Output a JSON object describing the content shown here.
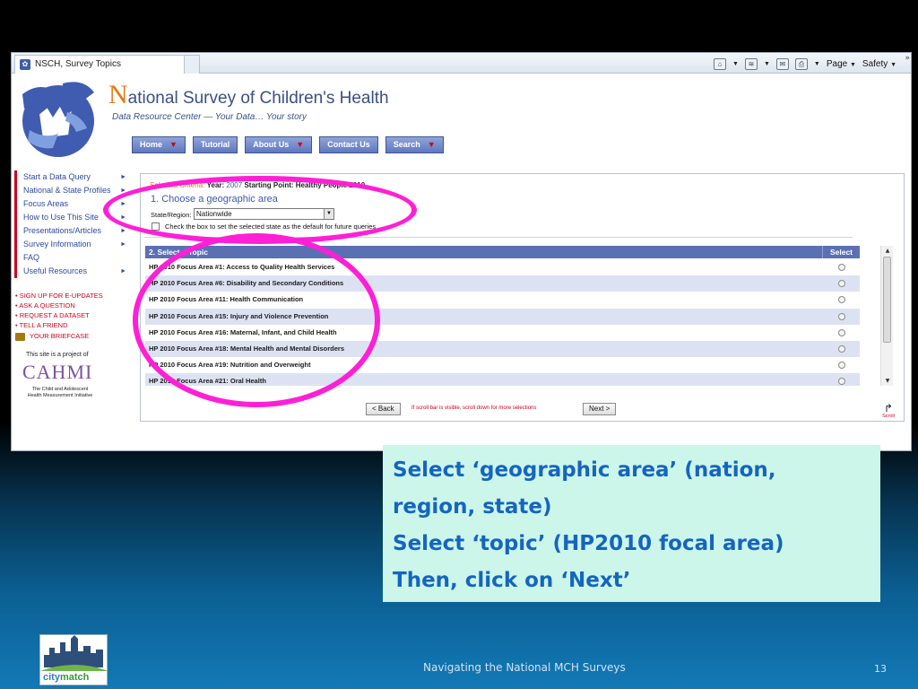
{
  "browser": {
    "tab_title": "NSCH, Survey Topics",
    "cmd_page": "Page",
    "cmd_safety": "Safety"
  },
  "site": {
    "title_initial": "N",
    "title_rest": "ational Survey of Children's Health",
    "subtitle": "Data Resource Center — Your Data… Your story",
    "nav": [
      {
        "label": "Home",
        "has_menu": true
      },
      {
        "label": "Tutorial",
        "has_menu": false
      },
      {
        "label": "About Us",
        "has_menu": true
      },
      {
        "label": "Contact Us",
        "has_menu": false
      },
      {
        "label": "Search",
        "has_menu": true
      }
    ]
  },
  "sidebar": {
    "items": [
      "Start a Data Query",
      "National & State Profiles",
      "Focus Areas",
      "How to Use This Site",
      "Presentations/Articles",
      "Survey Information",
      "FAQ",
      "Useful Resources"
    ],
    "links": [
      "SIGN UP FOR E-UPDATES",
      "ASK A QUESTION",
      "REQUEST A DATASET",
      "TELL A FRIEND"
    ],
    "briefcase": "YOUR BRIEFCASE",
    "cahmi_note": "This site is a project of",
    "cahmi_name": "CAHMI",
    "cahmi_sub1": "The Child and Adolescent",
    "cahmi_sub2": "Health Measurement Initiative"
  },
  "form": {
    "criteria_label": "Selected Criteria:",
    "year_label": "Year:",
    "year_value": "2007",
    "starting_point": "Starting Point: Healthy People 2010",
    "geo_title": "1. Choose a geographic area",
    "state_label": "State/Region:",
    "state_value": "Nationwide",
    "default_checkbox_label": "Check the box to set the selected state as the default for future queries",
    "topic_header": "2. Select a Topic",
    "select_header": "Select",
    "topics": [
      "HP 2010 Focus Area #1: Access to Quality Health Services",
      "HP 2010 Focus Area #6: Disability and Secondary Conditions",
      "HP 2010 Focus Area #11: Health Communication",
      "HP 2010 Focus Area #15: Injury and Violence Prevention",
      "HP 2010 Focus Area #16: Maternal, Infant, and Child Health",
      "HP 2010 Focus Area #18: Mental Health and Mental Disorders",
      "HP 2010 Focus Area #19: Nutrition and Overweight",
      "HP 2010 Focus Area #21: Oral Health"
    ],
    "back_label": "< Back",
    "next_label": "Next >",
    "scroll_note": "If scroll bar is visible, scroll down for more selections",
    "scroll_icon_label": "Scroll"
  },
  "slide": {
    "caption_lines": [
      "Select ‘geographic area’ (nation,",
      "region, state)",
      "Select ‘topic’ (HP2010 focal area)",
      "Then, click on ‘Next’"
    ],
    "footer": "Navigating the National MCH Surveys",
    "page_number": "13",
    "logo_text_a": "city",
    "logo_text_b": "match"
  },
  "colors": {
    "highlight": "#ff1fd6",
    "caption_bg": "#ccf6ea",
    "caption_text": "#1565c0",
    "nav_blue": "#5f78bf",
    "accent_orange": "#e07b12"
  }
}
